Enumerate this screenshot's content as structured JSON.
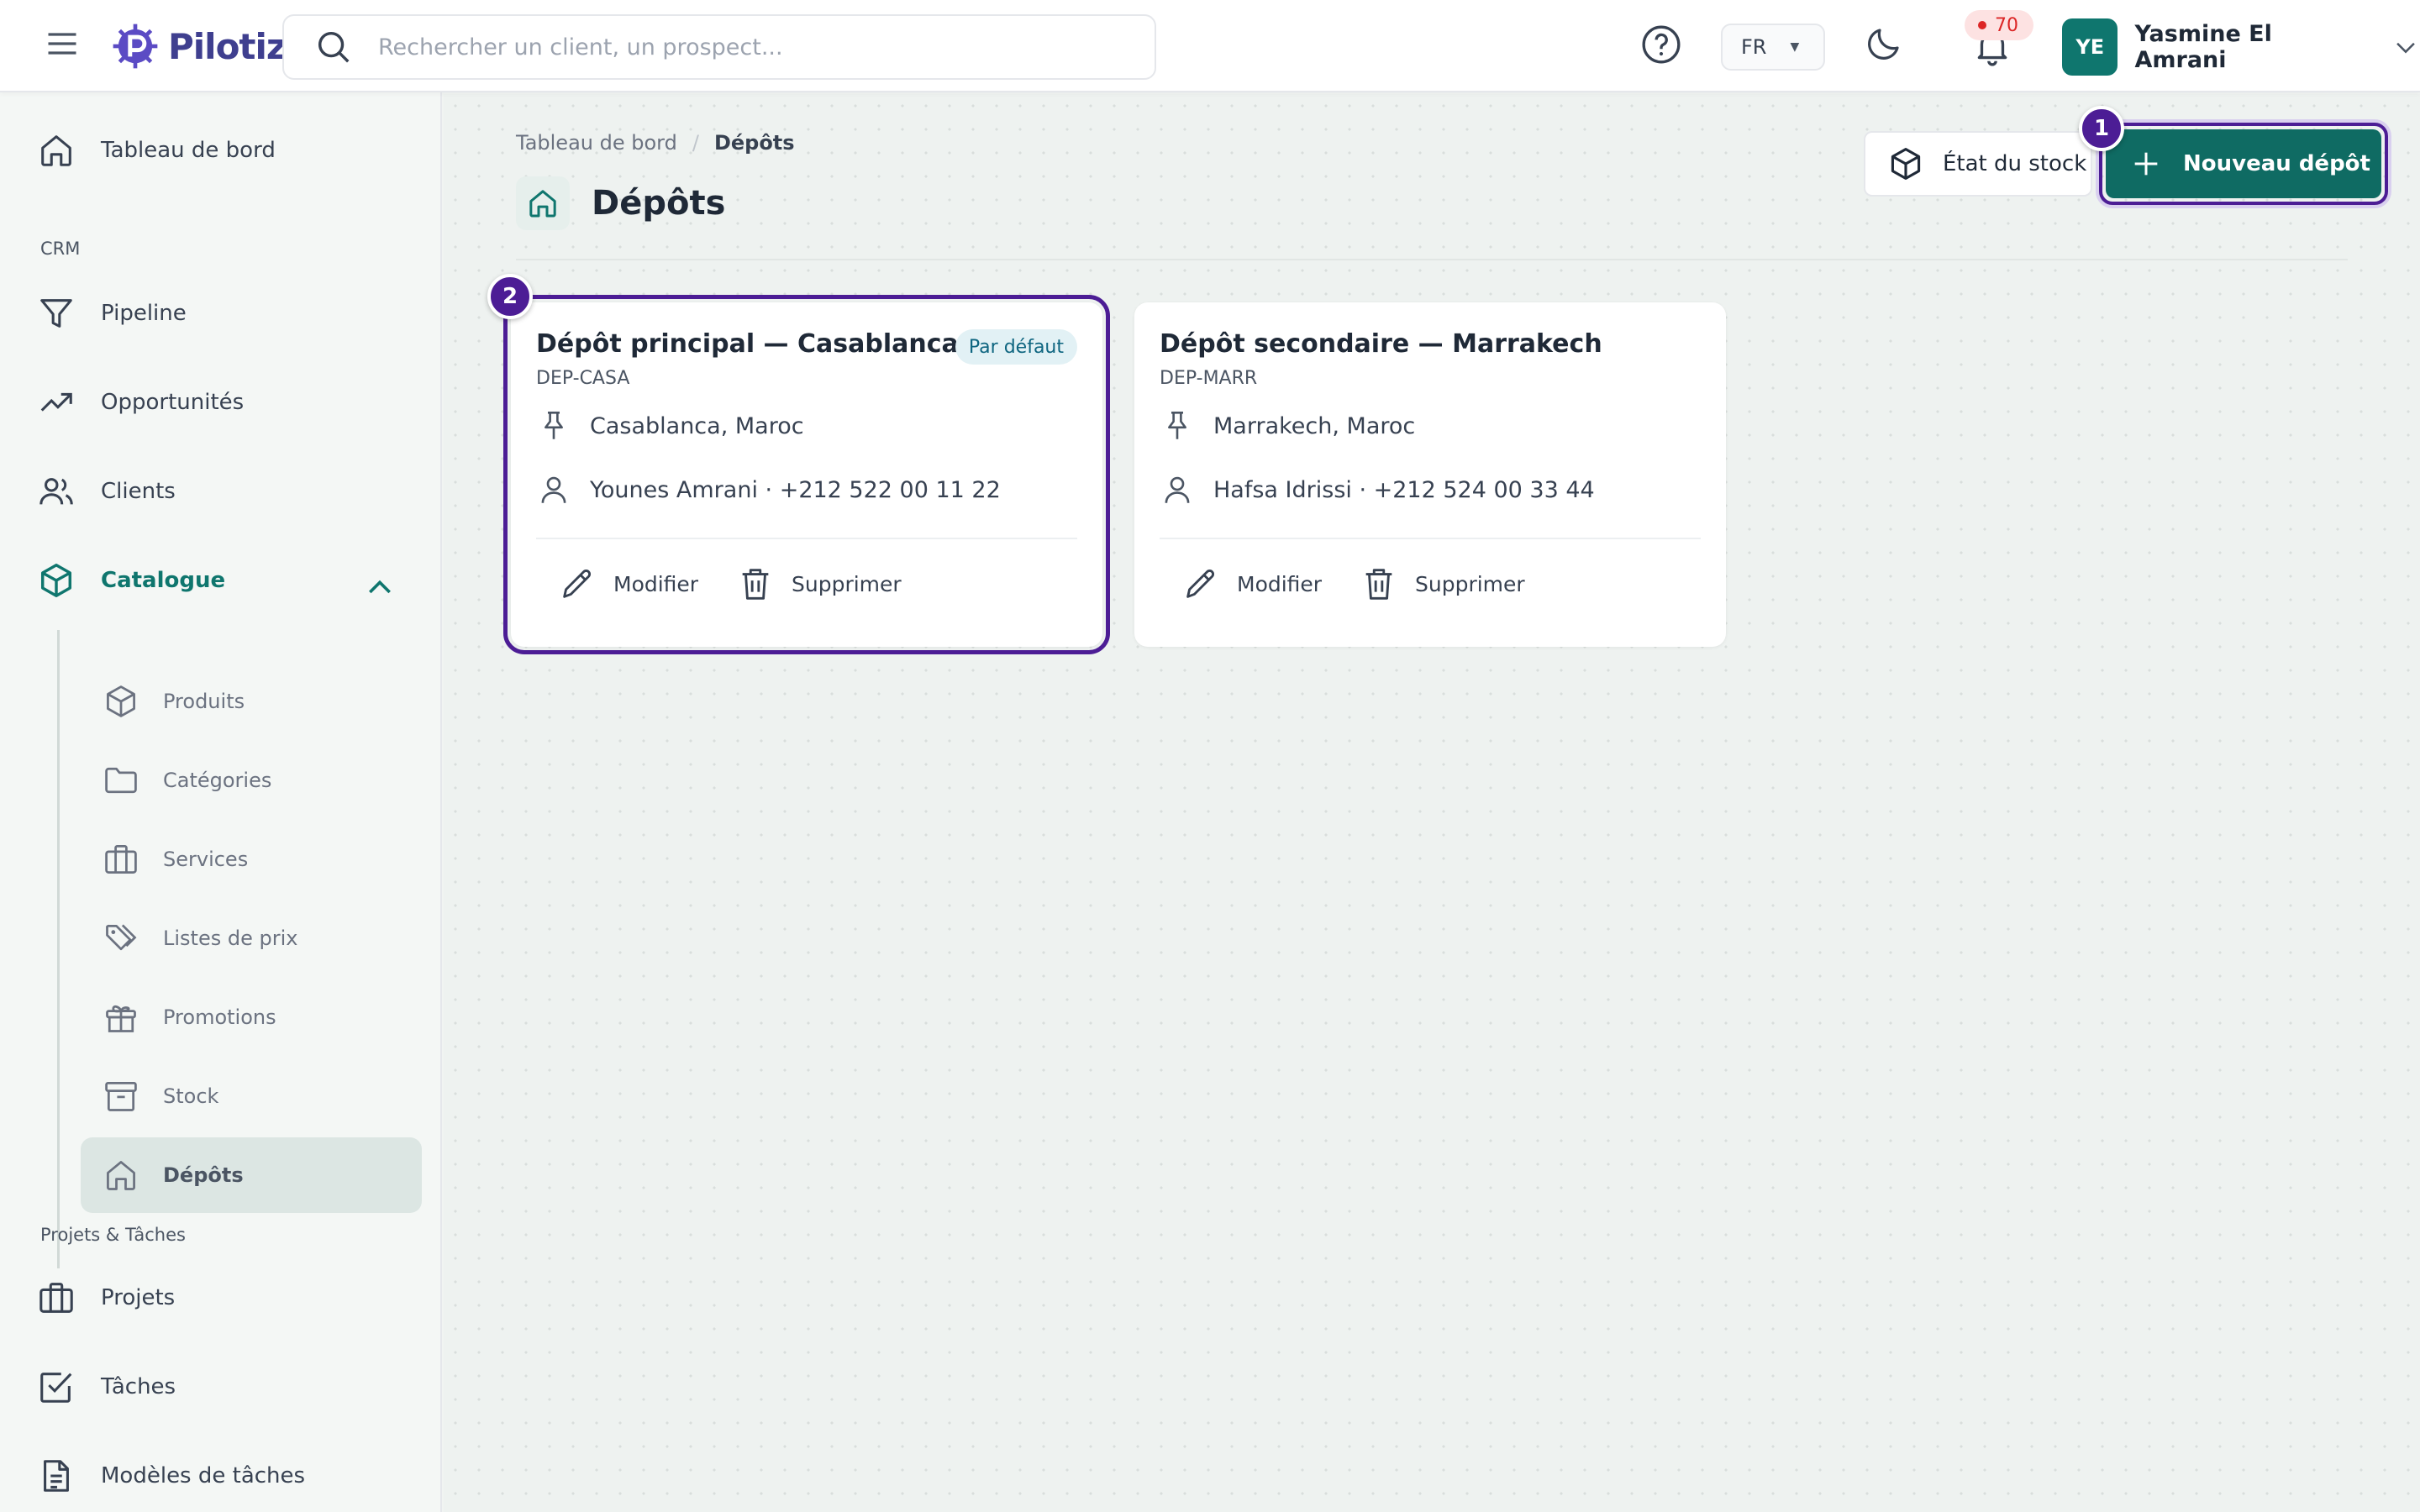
{
  "app": {
    "name": "Pilotiz"
  },
  "search": {
    "placeholder": "Rechercher un client, un prospect..."
  },
  "header": {
    "language": "FR",
    "notifications_count": "70",
    "user": {
      "initials": "YE",
      "name": "Yasmine El Amrani"
    }
  },
  "sidebar": {
    "dashboard": "Tableau de bord",
    "crm_section": "CRM",
    "crm_items": [
      "Pipeline",
      "Opportunités",
      "Clients"
    ],
    "catalogue": "Catalogue",
    "catalogue_items": [
      "Produits",
      "Catégories",
      "Services",
      "Listes de prix",
      "Promotions",
      "Stock",
      "Dépôts"
    ],
    "projects_section": "Projets & Tâches",
    "project_items": [
      "Projets",
      "Tâches",
      "Modèles de tâches"
    ]
  },
  "breadcrumb": {
    "root": "Tableau de bord",
    "separator": "/",
    "current": "Dépôts"
  },
  "page": {
    "title": "Dépôts",
    "stock_button": "État du stock",
    "new_button": "Nouveau dépôt"
  },
  "markers": [
    "1",
    "2"
  ],
  "depots": [
    {
      "name": "Dépôt principal — Casablanca",
      "code": "DEP-CASA",
      "badge": "Par défaut",
      "location": "Casablanca, Maroc",
      "contact": "Younes Amrani · +212 522 00 11 22",
      "edit_label": "Modifier",
      "delete_label": "Supprimer"
    },
    {
      "name": "Dépôt secondaire — Marrakech",
      "code": "DEP-MARR",
      "location": "Marrakech, Maroc",
      "contact": "Hafsa Idrissi · +212 524 00 33 44",
      "edit_label": "Modifier",
      "delete_label": "Supprimer"
    }
  ],
  "colors": {
    "primary": "#0f6b63",
    "accent_marker": "#4c1d95",
    "brand": "#3f3f8f",
    "notification": "#dc2626"
  }
}
